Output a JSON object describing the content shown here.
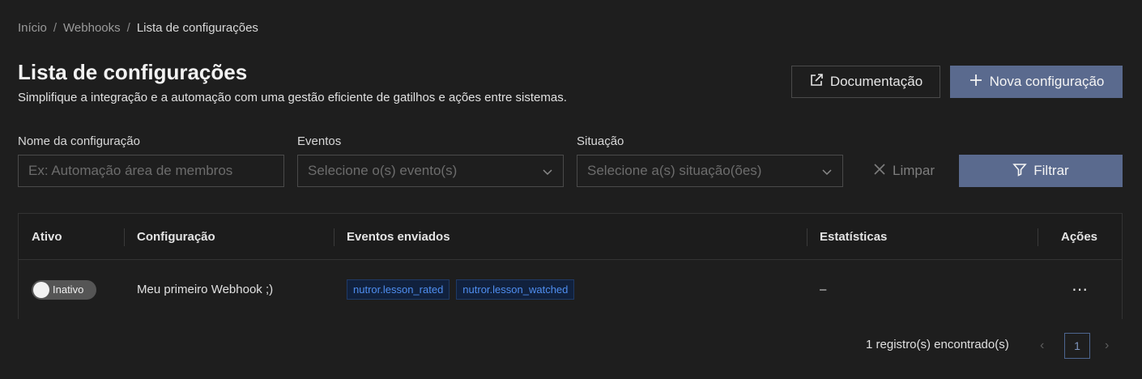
{
  "breadcrumb": {
    "items": [
      "Início",
      "Webhooks",
      "Lista de configurações"
    ],
    "separator": "/"
  },
  "header": {
    "title": "Lista de configurações",
    "subtitle": "Simplifique a integração e a automação com uma gestão eficiente de gatilhos e ações entre sistemas.",
    "docs_button": "Documentação",
    "new_button": "Nova configuração"
  },
  "filters": {
    "name": {
      "label": "Nome da configuração",
      "placeholder": "Ex: Automação área de membros"
    },
    "events": {
      "label": "Eventos",
      "placeholder": "Selecione o(s) evento(s)"
    },
    "status": {
      "label": "Situação",
      "placeholder": "Selecione a(s) situação(ões)"
    },
    "clear_button": "Limpar",
    "filter_button": "Filtrar"
  },
  "table": {
    "columns": [
      "Ativo",
      "Configuração",
      "Eventos enviados",
      "Estatísticas",
      "Ações"
    ],
    "rows": [
      {
        "active_label": "Inativo",
        "active": false,
        "name": "Meu primeiro Webhook ;)",
        "events": [
          "nutror.lesson_rated",
          "nutror.lesson_watched"
        ],
        "stats": "–",
        "actions": "⋯"
      }
    ]
  },
  "pagination": {
    "count_text": "1 registro(s) encontrado(s)",
    "current_page": "1",
    "prev": "‹",
    "next": "›"
  },
  "colors": {
    "background": "#1e1e1e",
    "primary_button": "#5a6a8e",
    "tag_text": "#4f8ef0"
  }
}
